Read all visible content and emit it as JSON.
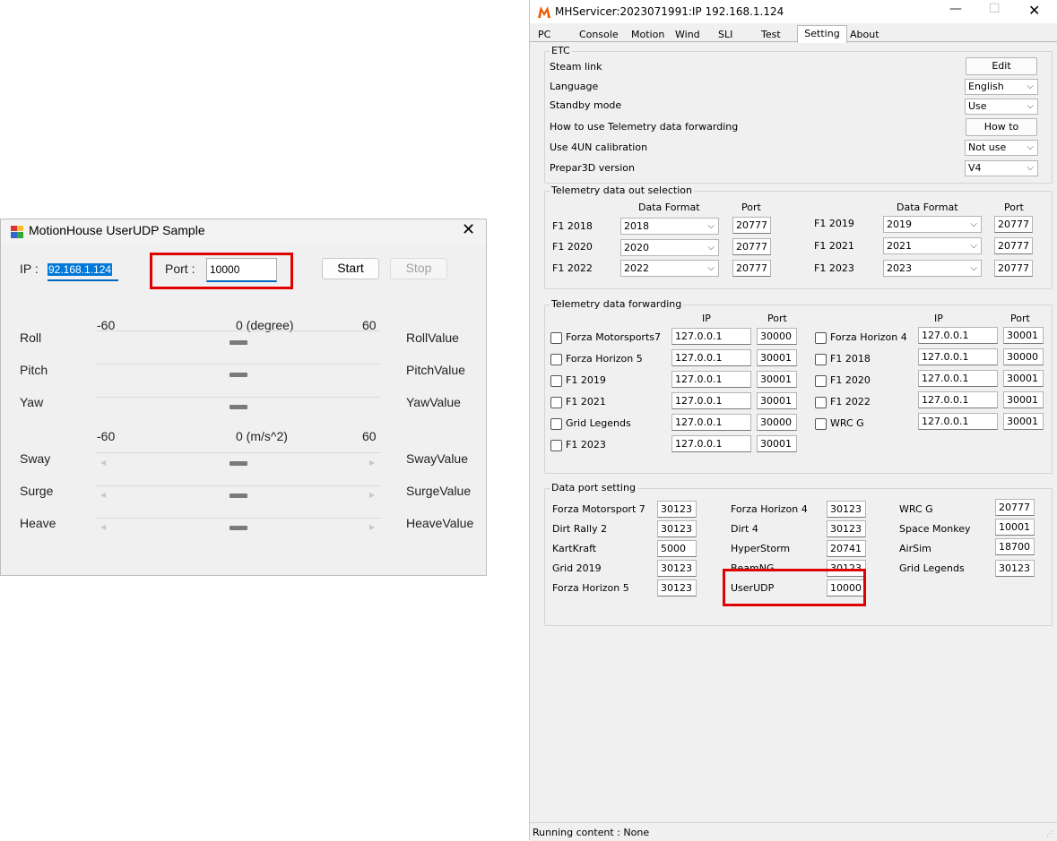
{
  "sample_window": {
    "title": "MotionHouse UserUDP Sample",
    "ip_label": "IP :",
    "ip_value": "92.168.1.124",
    "port_label": "Port :",
    "port_value": "10000",
    "start_label": "Start",
    "stop_label": "Stop",
    "rot_header": {
      "min": "-60",
      "unit": "0 (degree)",
      "max": "60"
    },
    "lin_header": {
      "min": "-60",
      "unit": "0 (m/s^2)",
      "max": "60"
    },
    "rows": [
      {
        "name": "Roll",
        "value": "RollValue"
      },
      {
        "name": "Pitch",
        "value": "PitchValue"
      },
      {
        "name": "Yaw",
        "value": "YawValue"
      },
      {
        "name": "Sway",
        "value": "SwayValue"
      },
      {
        "name": "Surge",
        "value": "SurgeValue"
      },
      {
        "name": "Heave",
        "value": "HeaveValue"
      }
    ]
  },
  "servicer": {
    "title": "MHServicer:2023071991:IP 192.168.1.124",
    "tabs": [
      "PC",
      "Console",
      "Motion",
      "Wind",
      "SLI",
      "Test",
      "Setting",
      "About"
    ],
    "active_tab": "Setting",
    "etc": {
      "title": "ETC",
      "steam_link": "Steam link",
      "edit_label": "Edit",
      "language": "Language",
      "language_value": "English",
      "standby": "Standby mode",
      "standby_value": "Use",
      "howto_text": "How to use Telemetry data forwarding",
      "howto_label": "How to",
      "calib": "Use 4UN calibration",
      "calib_value": "Not use",
      "prepar": "Prepar3D version",
      "prepar_value": "V4"
    },
    "telemetry_out": {
      "title": "Telemetry data out selection",
      "col_format": "Data Format",
      "col_port": "Port",
      "left": [
        {
          "name": "F1 2018",
          "format": "2018",
          "port": "20777"
        },
        {
          "name": "F1 2020",
          "format": "2020",
          "port": "20777"
        },
        {
          "name": "F1 2022",
          "format": "2022",
          "port": "20777"
        }
      ],
      "right": [
        {
          "name": "F1 2019",
          "format": "2019",
          "port": "20777"
        },
        {
          "name": "F1 2021",
          "format": "2021",
          "port": "20777"
        },
        {
          "name": "F1 2023",
          "format": "2023",
          "port": "20777"
        }
      ]
    },
    "forwarding": {
      "title": "Telemetry data forwarding",
      "col_ip": "IP",
      "col_port": "Port",
      "left": [
        {
          "name": "Forza Motorsports7",
          "ip": "127.0.0.1",
          "port": "30000"
        },
        {
          "name": "Forza Horizon 5",
          "ip": "127.0.0.1",
          "port": "30001"
        },
        {
          "name": "F1 2019",
          "ip": "127.0.0.1",
          "port": "30001"
        },
        {
          "name": "F1 2021",
          "ip": "127.0.0.1",
          "port": "30001"
        },
        {
          "name": "Grid Legends",
          "ip": "127.0.0.1",
          "port": "30000"
        },
        {
          "name": "F1 2023",
          "ip": "127.0.0.1",
          "port": "30001"
        }
      ],
      "right": [
        {
          "name": "Forza Horizon 4",
          "ip": "127.0.0.1",
          "port": "30001"
        },
        {
          "name": "F1 2018",
          "ip": "127.0.0.1",
          "port": "30000"
        },
        {
          "name": "F1 2020",
          "ip": "127.0.0.1",
          "port": "30001"
        },
        {
          "name": "F1 2022",
          "ip": "127.0.0.1",
          "port": "30001"
        },
        {
          "name": "WRC G",
          "ip": "127.0.0.1",
          "port": "30001"
        }
      ]
    },
    "data_port": {
      "title": "Data port setting",
      "col1": [
        {
          "name": "Forza Motorsport 7",
          "port": "30123"
        },
        {
          "name": "Dirt Rally 2",
          "port": "30123"
        },
        {
          "name": "KartKraft",
          "port": "5000"
        },
        {
          "name": "Grid 2019",
          "port": "30123"
        },
        {
          "name": "Forza Horizon 5",
          "port": "30123"
        }
      ],
      "col2": [
        {
          "name": "Forza Horizon 4",
          "port": "30123"
        },
        {
          "name": "Dirt 4",
          "port": "30123"
        },
        {
          "name": "HyperStorm",
          "port": "20741"
        },
        {
          "name": "BeamNG",
          "port": "30123"
        },
        {
          "name": "UserUDP",
          "port": "10000"
        }
      ],
      "col3": [
        {
          "name": "WRC G",
          "port": "20777"
        },
        {
          "name": "Space Monkey",
          "port": "10001"
        },
        {
          "name": "AirSim",
          "port": "18700"
        },
        {
          "name": "Grid Legends",
          "port": "30123"
        }
      ]
    },
    "status": "Running content : None"
  },
  "colors": {
    "highlight": "#e00000",
    "accent": "#0067c0"
  }
}
